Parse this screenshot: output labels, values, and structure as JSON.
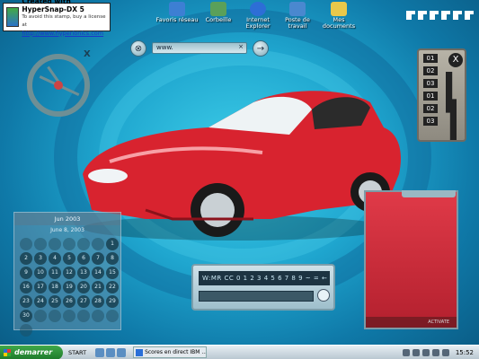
{
  "watermark": {
    "line1": "Created with HyperSnap-DX 5",
    "line2": "To avoid this stamp, buy a license at",
    "line3": "http://www.hyperionics.com"
  },
  "desktop_icons": [
    {
      "label": "Favoris réseau",
      "color": "#3d7fd3"
    },
    {
      "label": "Corbeille",
      "color": "#5aa05a"
    },
    {
      "label": "Internet Explorer",
      "color": "#2d6ed6"
    },
    {
      "label": "Poste de travail",
      "color": "#4a88cf"
    },
    {
      "label": "Mes documents",
      "color": "#e9c84a"
    }
  ],
  "url_bar": {
    "value": "www.",
    "clear_glyph": "×",
    "go_glyph": "→",
    "close_glyph": "⊗"
  },
  "steering_close": "X",
  "gear_panel": {
    "gears": [
      "01",
      "02",
      "03",
      "01",
      "02",
      "03"
    ],
    "knob": "X"
  },
  "calendar": {
    "header": "Jun 2003",
    "date": "June 8, 2003",
    "days": [
      "",
      "",
      "",
      "",
      "",
      "",
      "1",
      "2",
      "3",
      "4",
      "5",
      "6",
      "7",
      "8",
      "9",
      "10",
      "11",
      "12",
      "13",
      "14",
      "15",
      "16",
      "17",
      "18",
      "19",
      "20",
      "21",
      "22",
      "23",
      "24",
      "25",
      "26",
      "27",
      "28",
      "29",
      "30",
      "",
      "",
      "",
      "",
      "",
      "",
      ""
    ]
  },
  "keyboard": {
    "display": "W:MR CC 0 1 2 3 4 5 6 7 8 9 ~ = ← +"
  },
  "red_panel": {
    "footer": "ACTIVATE"
  },
  "taskbar": {
    "start_label": "demarrer",
    "start_text": "START",
    "task_item": "Scores en direct IBM ...",
    "clock": "15:52"
  },
  "colors": {
    "accent": "#1fa6cf",
    "car": "#d8232f",
    "taskbar": "#c9d6de"
  }
}
